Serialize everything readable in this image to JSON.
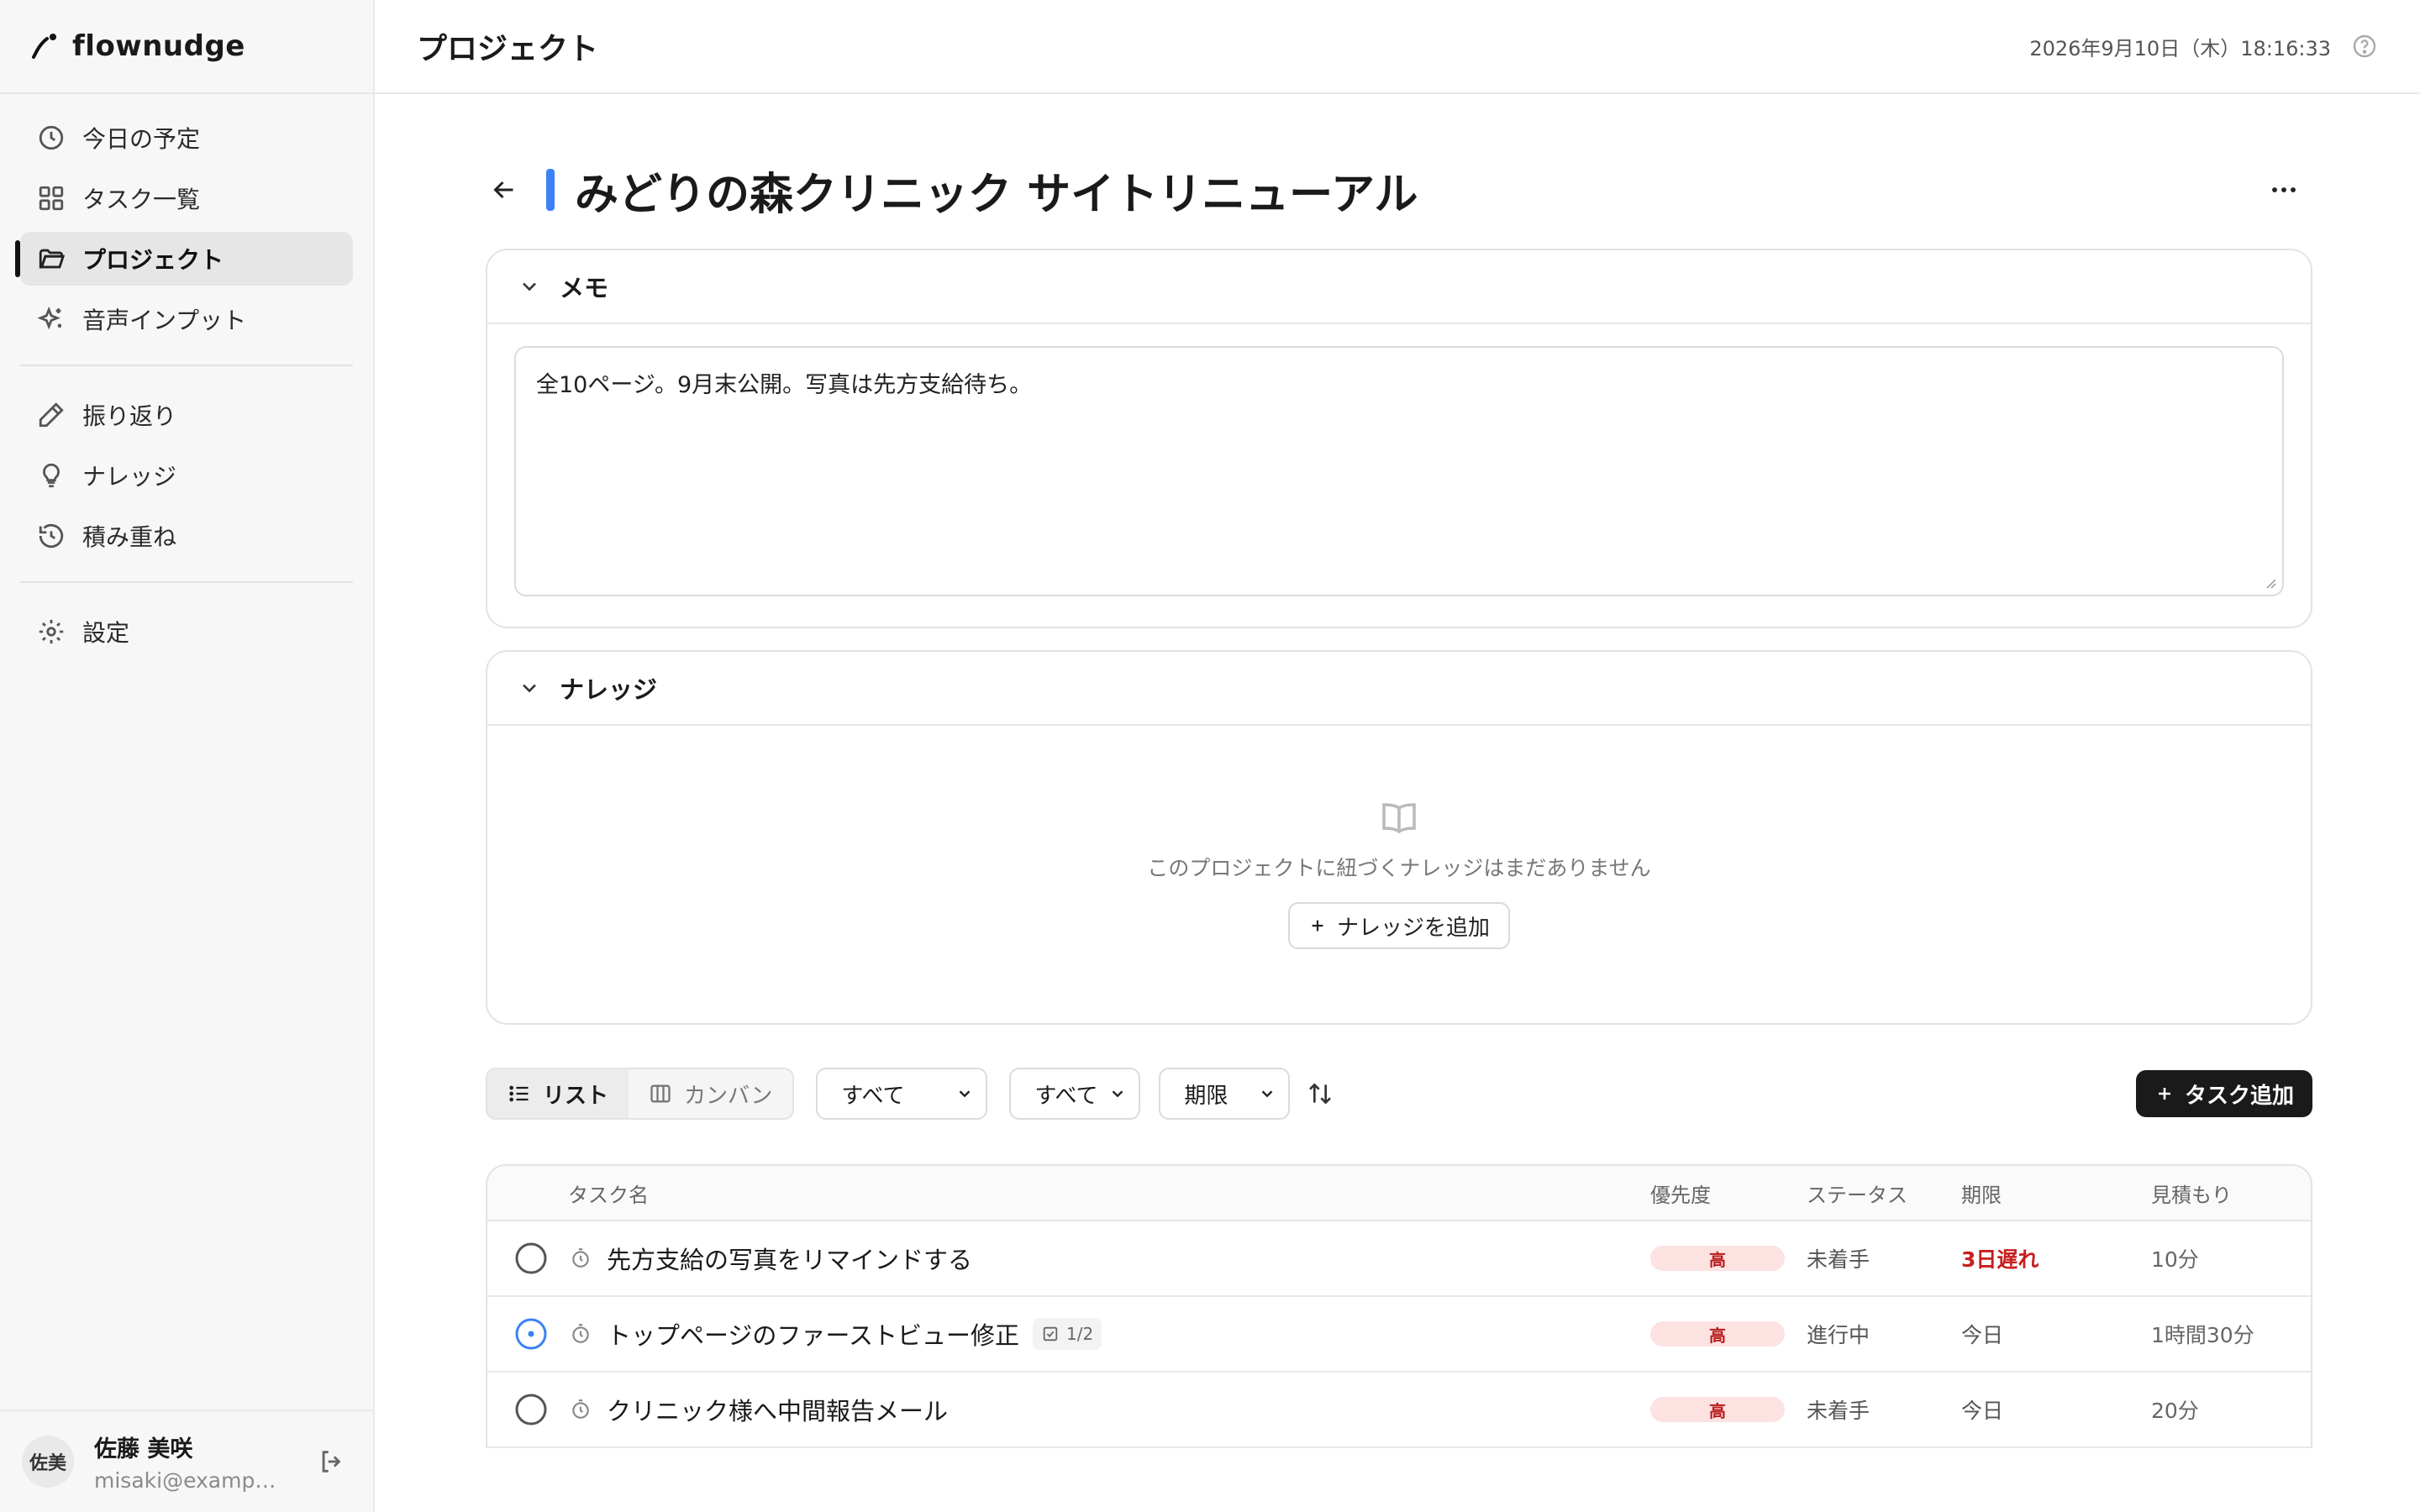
{
  "app": {
    "name": "flownudge"
  },
  "sidebar": {
    "items": [
      {
        "label": "今日の予定"
      },
      {
        "label": "タスク一覧"
      },
      {
        "label": "プロジェクト"
      },
      {
        "label": "音声インプット"
      },
      {
        "label": "振り返り"
      },
      {
        "label": "ナレッジ"
      },
      {
        "label": "積み重ね"
      },
      {
        "label": "設定"
      }
    ],
    "active_index": 2
  },
  "user": {
    "avatar_text": "佐美",
    "name": "佐藤 美咲",
    "email": "misaki@example.com"
  },
  "header": {
    "title": "プロジェクト",
    "datetime": "2026年9月10日（木）18:16:33"
  },
  "project": {
    "title": "みどりの森クリニック サイトリニューアル",
    "accent_color": "#3b82f6"
  },
  "memo": {
    "heading": "メモ",
    "text": "全10ページ。9月末公開。写真は先方支給待ち。"
  },
  "knowledge": {
    "heading": "ナレッジ",
    "empty_text": "このプロジェクトに紐づくナレッジはまだありません",
    "add_label": "ナレッジを追加"
  },
  "toolbar": {
    "view_list": "リスト",
    "view_kanban": "カンバン",
    "filter1": "すべて",
    "filter2": "すべて",
    "sort": "期限",
    "add_task": "タスク追加"
  },
  "table": {
    "headers": {
      "name": "タスク名",
      "priority": "優先度",
      "status": "ステータス",
      "due": "期限",
      "estimate": "見積もり"
    },
    "rows": [
      {
        "name": "先方支給の写真をリマインドする",
        "priority": "高",
        "status": "未着手",
        "due": "3日遅れ",
        "estimate": "10分"
      },
      {
        "name": "トップページのファーストビュー修正",
        "subtasks": "1/2",
        "priority": "高",
        "status": "進行中",
        "due": "今日",
        "estimate": "1時間30分"
      },
      {
        "name": "クリニック様へ中間報告メール",
        "priority": "高",
        "status": "未着手",
        "due": "今日",
        "estimate": "20分"
      }
    ]
  },
  "colors": {
    "accent": "#3b82f6",
    "high_priority": "#b91c1c",
    "overdue": "#c81e1e"
  }
}
